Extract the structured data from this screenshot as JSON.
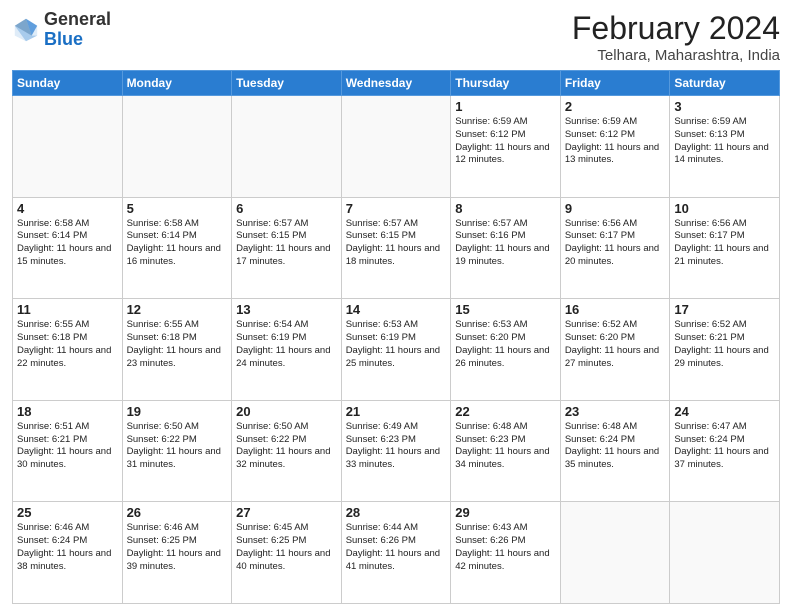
{
  "header": {
    "logo_general": "General",
    "logo_blue": "Blue",
    "month_title": "February 2024",
    "location": "Telhara, Maharashtra, India"
  },
  "weekdays": [
    "Sunday",
    "Monday",
    "Tuesday",
    "Wednesday",
    "Thursday",
    "Friday",
    "Saturday"
  ],
  "weeks": [
    [
      {
        "day": "",
        "info": ""
      },
      {
        "day": "",
        "info": ""
      },
      {
        "day": "",
        "info": ""
      },
      {
        "day": "",
        "info": ""
      },
      {
        "day": "1",
        "info": "Sunrise: 6:59 AM\nSunset: 6:12 PM\nDaylight: 11 hours\nand 12 minutes."
      },
      {
        "day": "2",
        "info": "Sunrise: 6:59 AM\nSunset: 6:12 PM\nDaylight: 11 hours\nand 13 minutes."
      },
      {
        "day": "3",
        "info": "Sunrise: 6:59 AM\nSunset: 6:13 PM\nDaylight: 11 hours\nand 14 minutes."
      }
    ],
    [
      {
        "day": "4",
        "info": "Sunrise: 6:58 AM\nSunset: 6:14 PM\nDaylight: 11 hours\nand 15 minutes."
      },
      {
        "day": "5",
        "info": "Sunrise: 6:58 AM\nSunset: 6:14 PM\nDaylight: 11 hours\nand 16 minutes."
      },
      {
        "day": "6",
        "info": "Sunrise: 6:57 AM\nSunset: 6:15 PM\nDaylight: 11 hours\nand 17 minutes."
      },
      {
        "day": "7",
        "info": "Sunrise: 6:57 AM\nSunset: 6:15 PM\nDaylight: 11 hours\nand 18 minutes."
      },
      {
        "day": "8",
        "info": "Sunrise: 6:57 AM\nSunset: 6:16 PM\nDaylight: 11 hours\nand 19 minutes."
      },
      {
        "day": "9",
        "info": "Sunrise: 6:56 AM\nSunset: 6:17 PM\nDaylight: 11 hours\nand 20 minutes."
      },
      {
        "day": "10",
        "info": "Sunrise: 6:56 AM\nSunset: 6:17 PM\nDaylight: 11 hours\nand 21 minutes."
      }
    ],
    [
      {
        "day": "11",
        "info": "Sunrise: 6:55 AM\nSunset: 6:18 PM\nDaylight: 11 hours\nand 22 minutes."
      },
      {
        "day": "12",
        "info": "Sunrise: 6:55 AM\nSunset: 6:18 PM\nDaylight: 11 hours\nand 23 minutes."
      },
      {
        "day": "13",
        "info": "Sunrise: 6:54 AM\nSunset: 6:19 PM\nDaylight: 11 hours\nand 24 minutes."
      },
      {
        "day": "14",
        "info": "Sunrise: 6:53 AM\nSunset: 6:19 PM\nDaylight: 11 hours\nand 25 minutes."
      },
      {
        "day": "15",
        "info": "Sunrise: 6:53 AM\nSunset: 6:20 PM\nDaylight: 11 hours\nand 26 minutes."
      },
      {
        "day": "16",
        "info": "Sunrise: 6:52 AM\nSunset: 6:20 PM\nDaylight: 11 hours\nand 27 minutes."
      },
      {
        "day": "17",
        "info": "Sunrise: 6:52 AM\nSunset: 6:21 PM\nDaylight: 11 hours\nand 29 minutes."
      }
    ],
    [
      {
        "day": "18",
        "info": "Sunrise: 6:51 AM\nSunset: 6:21 PM\nDaylight: 11 hours\nand 30 minutes."
      },
      {
        "day": "19",
        "info": "Sunrise: 6:50 AM\nSunset: 6:22 PM\nDaylight: 11 hours\nand 31 minutes."
      },
      {
        "day": "20",
        "info": "Sunrise: 6:50 AM\nSunset: 6:22 PM\nDaylight: 11 hours\nand 32 minutes."
      },
      {
        "day": "21",
        "info": "Sunrise: 6:49 AM\nSunset: 6:23 PM\nDaylight: 11 hours\nand 33 minutes."
      },
      {
        "day": "22",
        "info": "Sunrise: 6:48 AM\nSunset: 6:23 PM\nDaylight: 11 hours\nand 34 minutes."
      },
      {
        "day": "23",
        "info": "Sunrise: 6:48 AM\nSunset: 6:24 PM\nDaylight: 11 hours\nand 35 minutes."
      },
      {
        "day": "24",
        "info": "Sunrise: 6:47 AM\nSunset: 6:24 PM\nDaylight: 11 hours\nand 37 minutes."
      }
    ],
    [
      {
        "day": "25",
        "info": "Sunrise: 6:46 AM\nSunset: 6:24 PM\nDaylight: 11 hours\nand 38 minutes."
      },
      {
        "day": "26",
        "info": "Sunrise: 6:46 AM\nSunset: 6:25 PM\nDaylight: 11 hours\nand 39 minutes."
      },
      {
        "day": "27",
        "info": "Sunrise: 6:45 AM\nSunset: 6:25 PM\nDaylight: 11 hours\nand 40 minutes."
      },
      {
        "day": "28",
        "info": "Sunrise: 6:44 AM\nSunset: 6:26 PM\nDaylight: 11 hours\nand 41 minutes."
      },
      {
        "day": "29",
        "info": "Sunrise: 6:43 AM\nSunset: 6:26 PM\nDaylight: 11 hours\nand 42 minutes."
      },
      {
        "day": "",
        "info": ""
      },
      {
        "day": "",
        "info": ""
      }
    ]
  ]
}
